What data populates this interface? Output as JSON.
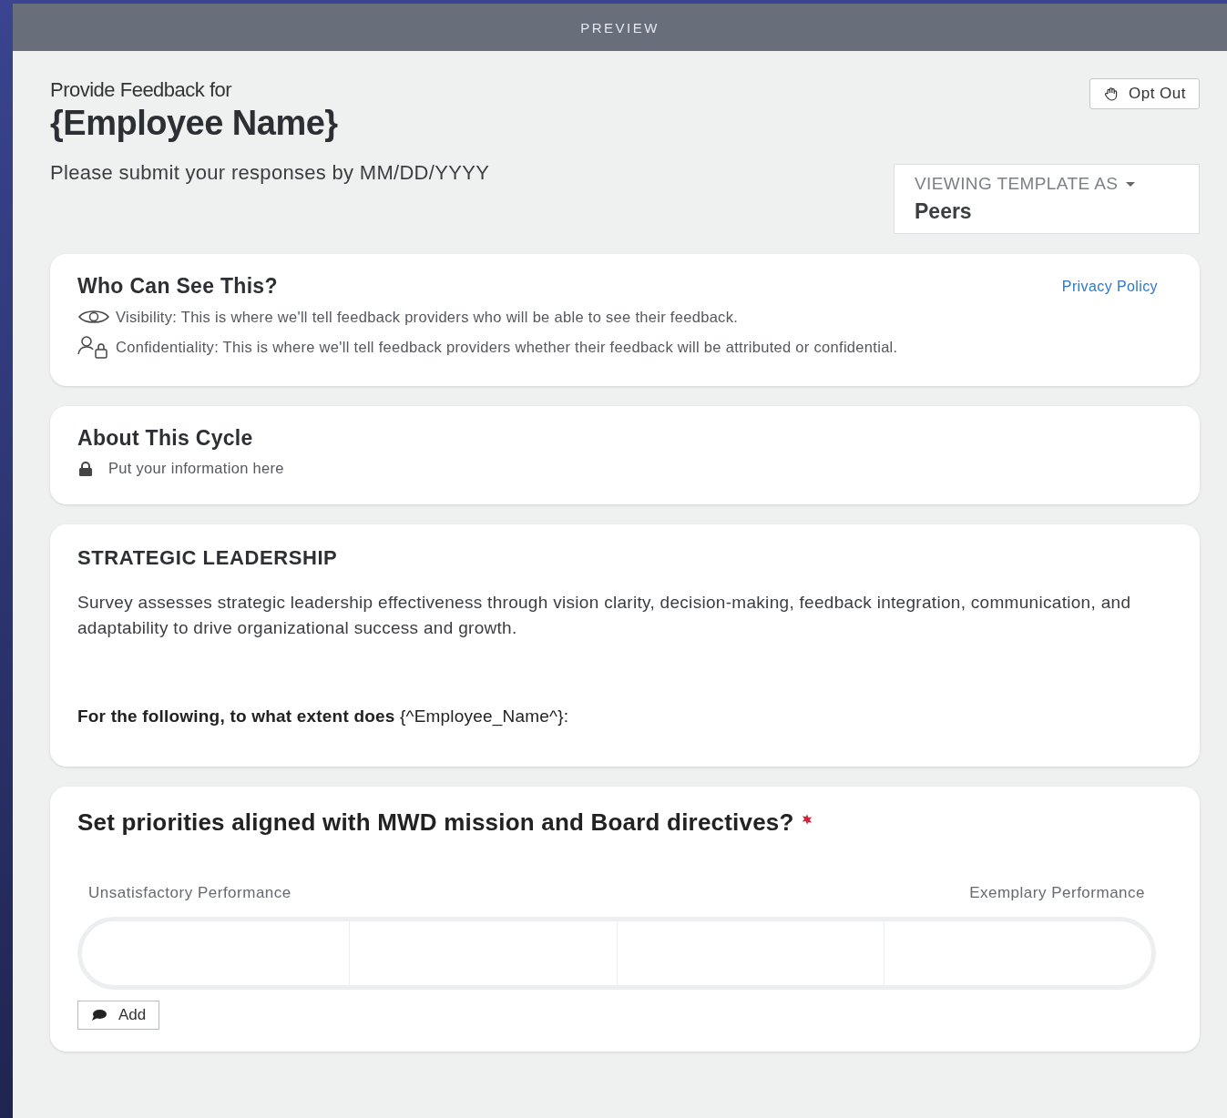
{
  "header": {
    "title": "PREVIEW"
  },
  "intro": {
    "label": "Provide Feedback for",
    "employee": "{Employee Name}",
    "due": "Please submit your responses by MM/DD/YYYY",
    "opt_out": "Opt Out"
  },
  "template_selector": {
    "label": "VIEWING TEMPLATE AS",
    "value": "Peers"
  },
  "visibility_card": {
    "title": "Who Can See This?",
    "link": "Privacy Policy",
    "items": [
      {
        "kind": "visibility",
        "text": "Visibility: This is where we'll tell feedback providers who will be able to see their feedback."
      },
      {
        "kind": "confidentiality",
        "text": "Confidentiality: This is where we'll tell feedback providers whether their feedback will be attributed or confidential."
      }
    ]
  },
  "cycle_card": {
    "title": "About This Cycle",
    "text": "Put your information here"
  },
  "section_card": {
    "title": "STRATEGIC LEADERSHIP",
    "description": "Survey assesses strategic leadership effectiveness through vision clarity, decision-making, feedback integration, communication, and adaptability to drive organizational success and growth.",
    "prompt": "**For the following, to what extent does** {^Employee_Name^}:"
  },
  "question_card": {
    "question": "Set priorities aligned with MWD mission and Board directives?",
    "required": true,
    "low_label": "Unsatisfactory Performance",
    "high_label": "Exemplary Performance",
    "add_button": "Add"
  }
}
